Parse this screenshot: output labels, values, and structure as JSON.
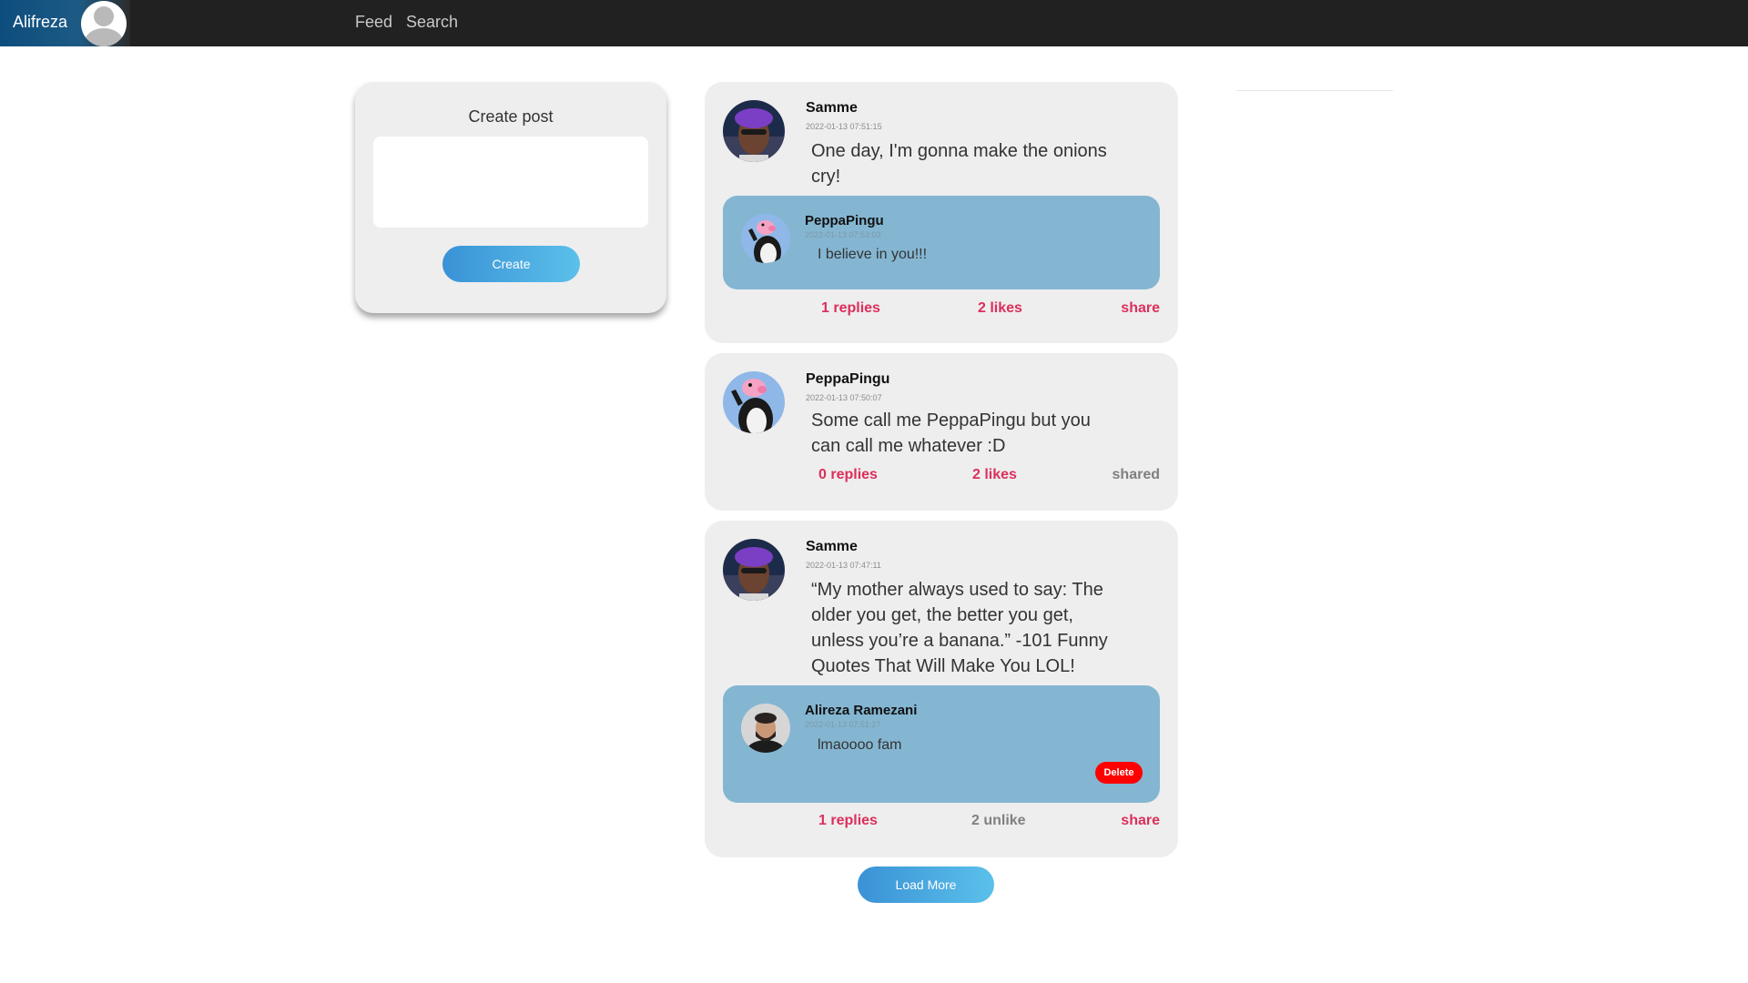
{
  "nav": {
    "brand": "Alifreza",
    "links": [
      "Feed",
      "Search"
    ]
  },
  "create_post": {
    "title": "Create post",
    "textarea_value": "",
    "button_label": "Create"
  },
  "posts": [
    {
      "author": "Samme",
      "timestamp": "2022-01-13 07:51:15",
      "text": "One day, I'm gonna make the onions cry!",
      "avatar": "samme-avatar",
      "reply": {
        "author": "PeppaPingu",
        "timestamp": "2022-01-13 07:53:03",
        "text": "I believe in you!!!",
        "avatar": "peppapingu-avatar"
      },
      "actions": {
        "replies": "1 replies",
        "likes": "2 likes",
        "share": "share"
      }
    },
    {
      "author": "PeppaPingu",
      "timestamp": "2022-01-13 07:50:07",
      "text": "Some call me PeppaPingu but you can call me whatever :D",
      "avatar": "peppapingu-avatar",
      "actions": {
        "replies": "0 replies",
        "likes": "2 likes",
        "share": "shared"
      }
    },
    {
      "author": "Samme",
      "timestamp": "2022-01-13 07:47:11",
      "text": "“My mother always used to say: The older you get, the better you get, unless you’re a banana.” -101 Funny Quotes That Will Make You LOL!",
      "avatar": "samme-avatar",
      "reply": {
        "author": "Alireza Ramezani",
        "timestamp": "2022-01-13 07:51:27",
        "text": "lmaoooo fam",
        "avatar": "alireza-avatar",
        "delete_label": "Delete"
      },
      "actions": {
        "replies": "1 replies",
        "likes": "2 unlike",
        "share": "share"
      }
    }
  ],
  "load_more_label": "Load More",
  "colors": {
    "navbar": "#212121",
    "card": "#eeeeee",
    "reply": "#84b6d2",
    "action": "#dc2f5a",
    "muted_action": "#808080",
    "delete": "#ff0000",
    "button_gradient_start": "#3a92d6",
    "button_gradient_end": "#5bc0ea"
  }
}
